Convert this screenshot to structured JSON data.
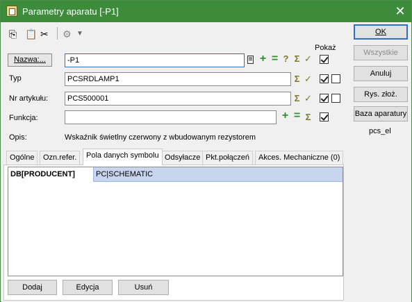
{
  "window": {
    "title": "Parametry aparatu [-P1]"
  },
  "toolbar": {
    "icons": [
      "copy-icon",
      "paste-icon",
      "cut-icon",
      "component-icon",
      "dropdown-arrow-icon"
    ]
  },
  "form": {
    "pokaz_label": "Pokaż",
    "nazwa": {
      "label": "Nazwa:...",
      "value": "-P1"
    },
    "typ": {
      "label": "Typ",
      "value": "PCSRDLAMP1"
    },
    "nr_artykulu": {
      "label": "Nr artykułu:",
      "value": "PCS500001"
    },
    "funkcja": {
      "label": "Funkcja:",
      "value": ""
    },
    "opis": {
      "label": "Opis:",
      "value": "Wskaźnik świetlny czerwony z wbudowanym rezystorem"
    }
  },
  "tabs": [
    {
      "label": "Ogólne"
    },
    {
      "label": "Ozn.refer."
    },
    {
      "label": "Pola danych symbolu"
    },
    {
      "label": "Odsyłacze"
    },
    {
      "label": "Pkt.połączeń"
    },
    {
      "label": "Akces. Mechaniczne (0)"
    }
  ],
  "grid": {
    "rows": [
      {
        "key": "DB[PRODUCENT]",
        "value": "PC|SCHEMATIC"
      }
    ]
  },
  "bottom_buttons": {
    "add": "Dodaj",
    "edit": "Edycja",
    "delete": "Usuń"
  },
  "side_buttons": {
    "ok": "OK",
    "all": "Wszystkie",
    "cancel": "Anuluj",
    "assembly_drawing": "Rys. złoż.",
    "device_base": "Baza aparatury"
  },
  "side_text": "pcs_el",
  "colors": {
    "titlebar": "#3c8c3c",
    "selection": "#c7d6ee",
    "accent": "#2d70c6"
  }
}
